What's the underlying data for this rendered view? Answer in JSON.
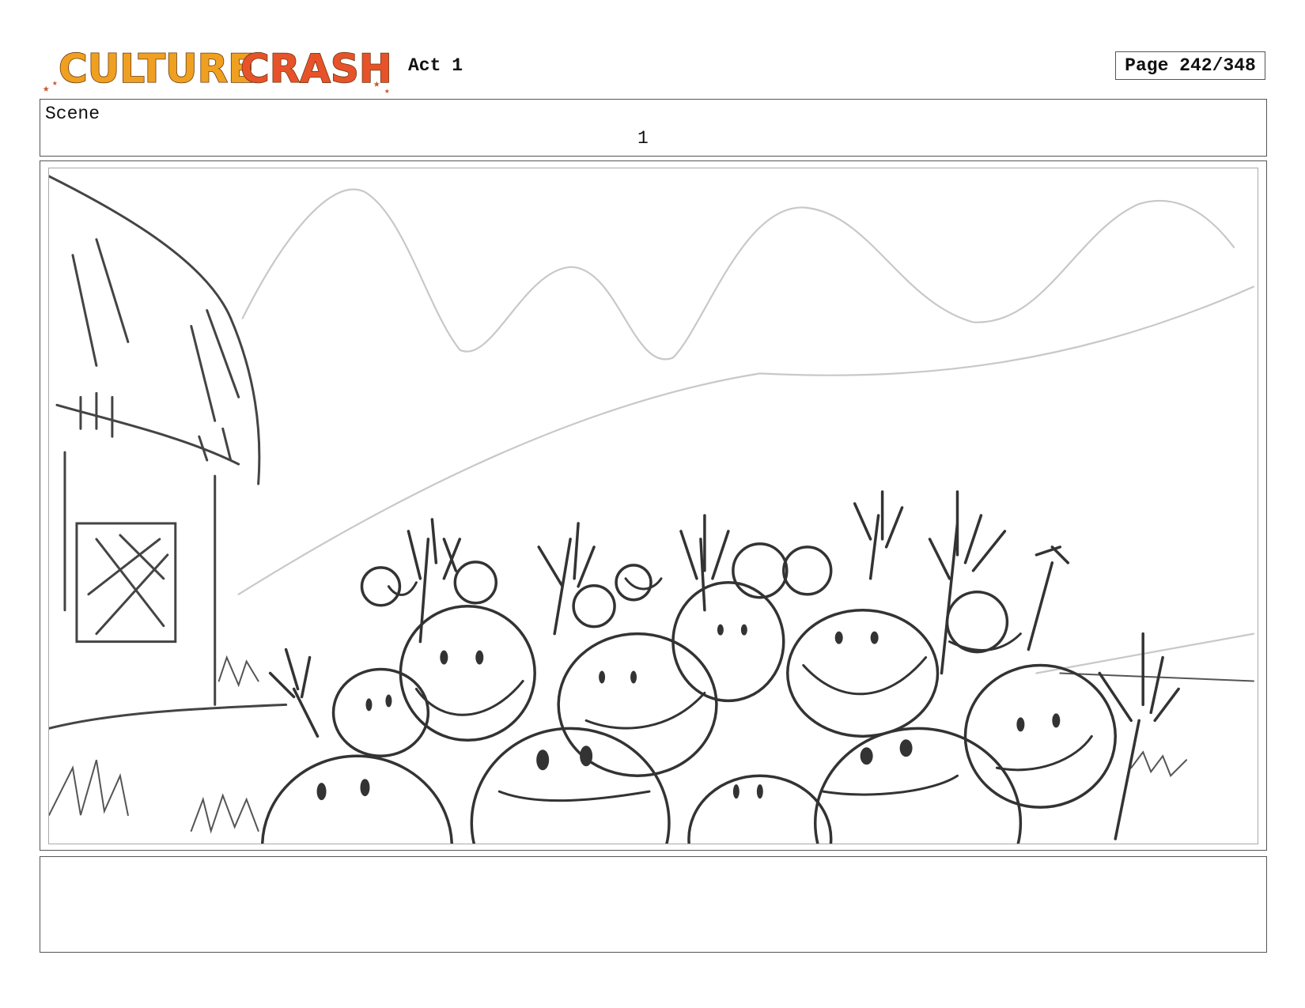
{
  "header": {
    "logo_text": "CULTURE CRASH",
    "act_label": "Act 1",
    "page_label": "Page 242/348"
  },
  "scene": {
    "label": "Scene",
    "number": "1"
  },
  "colors": {
    "logo_culture": "#f0a020",
    "logo_crash": "#e8522a",
    "frame_border": "#555555"
  },
  "panel": {
    "icon": "storyboard-sketch"
  }
}
